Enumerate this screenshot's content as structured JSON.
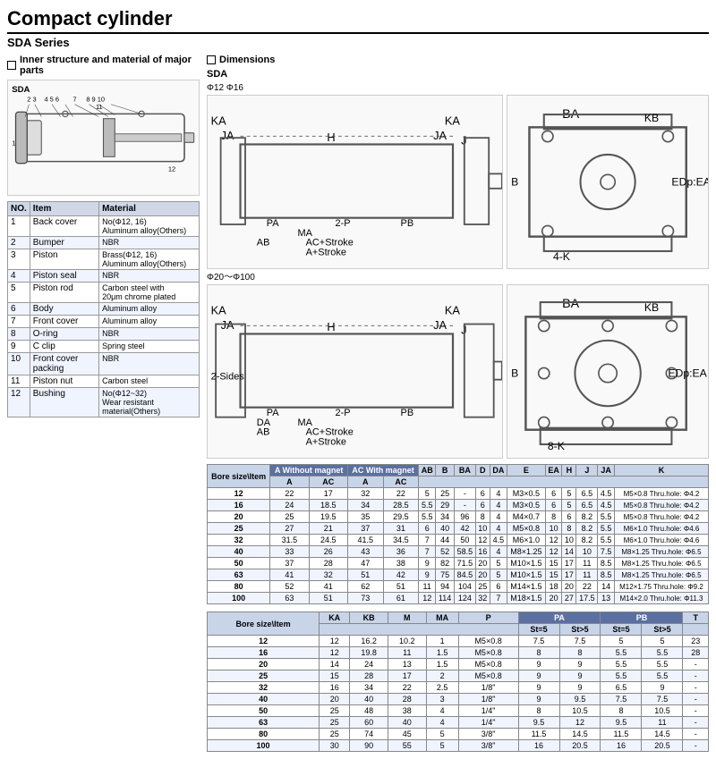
{
  "title": "Compact cylinder",
  "series": "SDA Series",
  "left_section_label": "Inner structure and material of major parts",
  "right_section_label": "Dimensions",
  "sda_label": "SDA",
  "parts": [
    {
      "no": "NO.",
      "item": "Item",
      "material": "Material",
      "is_header": true
    },
    {
      "no": "1",
      "item": "Back cover",
      "material": "No(Φ12, 16)\nAluminum alloy(Others)"
    },
    {
      "no": "2",
      "item": "Bumper",
      "material": "NBR"
    },
    {
      "no": "3",
      "item": "Piston",
      "material": "Brass(Φ12, 16)\nAluminum alloy(Others)"
    },
    {
      "no": "4",
      "item": "Piston seal",
      "material": "NBR"
    },
    {
      "no": "5",
      "item": "Piston rod",
      "material": "Carbon steel with\n20μm chrome plated"
    },
    {
      "no": "6",
      "item": "Body",
      "material": "Aluminum alloy"
    },
    {
      "no": "7",
      "item": "Front cover",
      "material": "Aluminum alloy"
    },
    {
      "no": "8",
      "item": "O-ring",
      "material": "NBR"
    },
    {
      "no": "9",
      "item": "C clip",
      "material": "Spring steel"
    },
    {
      "no": "10",
      "item": "Front cover packing",
      "material": "NBR"
    },
    {
      "no": "11",
      "item": "Piston nut",
      "material": "Carbon steel"
    },
    {
      "no": "12",
      "item": "Bushing",
      "material": "No(Φ12~32)\nWear resistant material(Others)"
    }
  ],
  "dim_table1_headers": [
    "Bore size\\Item",
    "A Without magnet",
    "AC Without magnet",
    "A With magnet",
    "AC With magnet",
    "AB",
    "B",
    "BA",
    "D",
    "DA",
    "E",
    "EA",
    "H",
    "J",
    "JA",
    "K"
  ],
  "dim_table1_rows": [
    [
      "12",
      "22",
      "17",
      "32",
      "22",
      "5",
      "25",
      "-",
      "6",
      "4",
      "M3×0.5",
      "6",
      "5",
      "6.5",
      "4.5",
      "M5×0.8 Thru.hole: Φ4.2"
    ],
    [
      "16",
      "24",
      "18.5",
      "34",
      "28.5",
      "5.5",
      "29",
      "-",
      "6",
      "4",
      "M3×0.5",
      "6",
      "5",
      "6.5",
      "4.5",
      "M5×0.8 Thru.hole: Φ4.2"
    ],
    [
      "20",
      "25",
      "19.5",
      "35",
      "29.5",
      "5.5",
      "34",
      "96",
      "8",
      "4",
      "M4×0.7",
      "8",
      "6",
      "8.2",
      "5.5",
      "M5×0.8 Thru.hole: Φ4.2"
    ],
    [
      "25",
      "27",
      "21",
      "37",
      "31",
      "6",
      "40",
      "42",
      "10",
      "4",
      "M5×0.8",
      "10",
      "8",
      "8.2",
      "5.5",
      "M6×1.0 Thru.hole: Φ4.6"
    ],
    [
      "32",
      "31.5",
      "24.5",
      "41.5",
      "34.5",
      "7",
      "44",
      "50",
      "12",
      "4.5",
      "M6×1.0",
      "12",
      "10",
      "8.2",
      "5.5",
      "M6×1.0 Thru.hole: Φ4.6"
    ],
    [
      "40",
      "33",
      "26",
      "43",
      "36",
      "7",
      "52",
      "58.5",
      "16",
      "4",
      "M8×1.25",
      "12",
      "14",
      "10",
      "7.5",
      "M8×1.25 Thru.hole: Φ6.5"
    ],
    [
      "50",
      "37",
      "28",
      "47",
      "38",
      "9",
      "82",
      "71.5",
      "20",
      "5",
      "M10×1.5",
      "15",
      "17",
      "11",
      "8.5",
      "M8×1.25 Thru.hole: Φ6.5"
    ],
    [
      "63",
      "41",
      "32",
      "51",
      "42",
      "9",
      "75",
      "84.5",
      "20",
      "5",
      "M10×1.5",
      "15",
      "17",
      "11",
      "8.5",
      "M8×1.25 Thru.hole: Φ6.5"
    ],
    [
      "80",
      "52",
      "41",
      "62",
      "51",
      "11",
      "94",
      "104",
      "25",
      "6",
      "M14×1.5",
      "18",
      "20",
      "22",
      "14",
      "M12×1.75 Thru.hole: Φ9.2"
    ],
    [
      "100",
      "63",
      "51",
      "73",
      "61",
      "12",
      "114",
      "124",
      "32",
      "7",
      "M18×1.5",
      "20",
      "27",
      "17.5",
      "13",
      "M14×2.0 Thru.hole: Φ11.3"
    ]
  ],
  "dim_table2_headers": [
    "Bore size\\Item",
    "KA",
    "KB",
    "M",
    "MA",
    "P",
    "PA St=5",
    "PA St>5",
    "PB St=5",
    "PB St>5",
    "T"
  ],
  "dim_table2_rows": [
    [
      "12",
      "12",
      "16.2",
      "10.2",
      "1",
      "M5×0.8",
      "7.5",
      "7.5",
      "5",
      "5",
      "23"
    ],
    [
      "16",
      "12",
      "19.8",
      "11",
      "1.5",
      "M5×0.8",
      "8",
      "8",
      "5.5",
      "5.5",
      "28"
    ],
    [
      "20",
      "14",
      "24",
      "13",
      "1.5",
      "M5×0.8",
      "9",
      "9",
      "5.5",
      "5.5",
      "-"
    ],
    [
      "25",
      "15",
      "28",
      "17",
      "2",
      "M5×0.8",
      "9",
      "9",
      "5.5",
      "5.5",
      "-"
    ],
    [
      "32",
      "16",
      "34",
      "22",
      "2.5",
      "1/8\"",
      "9",
      "9",
      "6.5",
      "9",
      "-"
    ],
    [
      "40",
      "20",
      "40",
      "28",
      "3",
      "1/8\"",
      "9",
      "9.5",
      "7.5",
      "7.5",
      "-"
    ],
    [
      "50",
      "25",
      "48",
      "38",
      "4",
      "1/4\"",
      "8",
      "10.5",
      "8",
      "10.5",
      "-"
    ],
    [
      "63",
      "25",
      "60",
      "40",
      "4",
      "1/4\"",
      "9.5",
      "12",
      "9.5",
      "11",
      "-"
    ],
    [
      "80",
      "25",
      "74",
      "45",
      "5",
      "3/8\"",
      "11.5",
      "14.5",
      "11.5",
      "14.5",
      "-"
    ],
    [
      "100",
      "30",
      "90",
      "55",
      "5",
      "3/8\"",
      "16",
      "20.5",
      "16",
      "20.5",
      "-"
    ]
  ]
}
